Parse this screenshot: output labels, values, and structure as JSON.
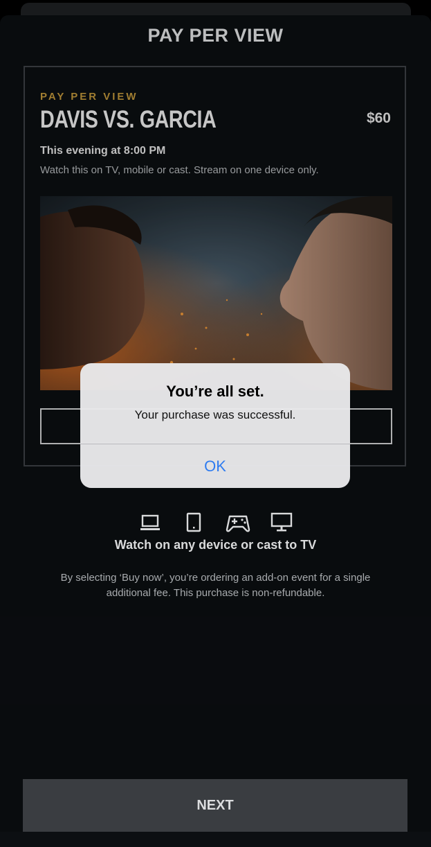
{
  "header": {
    "title": "PAY PER VIEW"
  },
  "card": {
    "eyebrow": "PAY PER VIEW",
    "title": "DAVIS VS. GARCIA",
    "price": "$60",
    "time": "This evening at 8:00 PM",
    "description": "Watch this on TV, mobile or cast. Stream on one device only."
  },
  "alert": {
    "title": "You’re all set.",
    "message": "Your purchase was successful.",
    "ok_label": "OK"
  },
  "devices": {
    "icons": [
      "laptop-icon",
      "phone-icon",
      "gamepad-icon",
      "tv-icon"
    ],
    "caption": "Watch on any device or cast to TV"
  },
  "disclaimer": "By selecting ‘Buy now’, you’re ordering an add-on event for a single additional fee. This purchase is non-refundable.",
  "footer": {
    "next_label": "NEXT"
  },
  "colors": {
    "accent_gold": "#c59a3c",
    "alert_button_blue": "#2f7cf0",
    "background": "#0c0f12"
  }
}
